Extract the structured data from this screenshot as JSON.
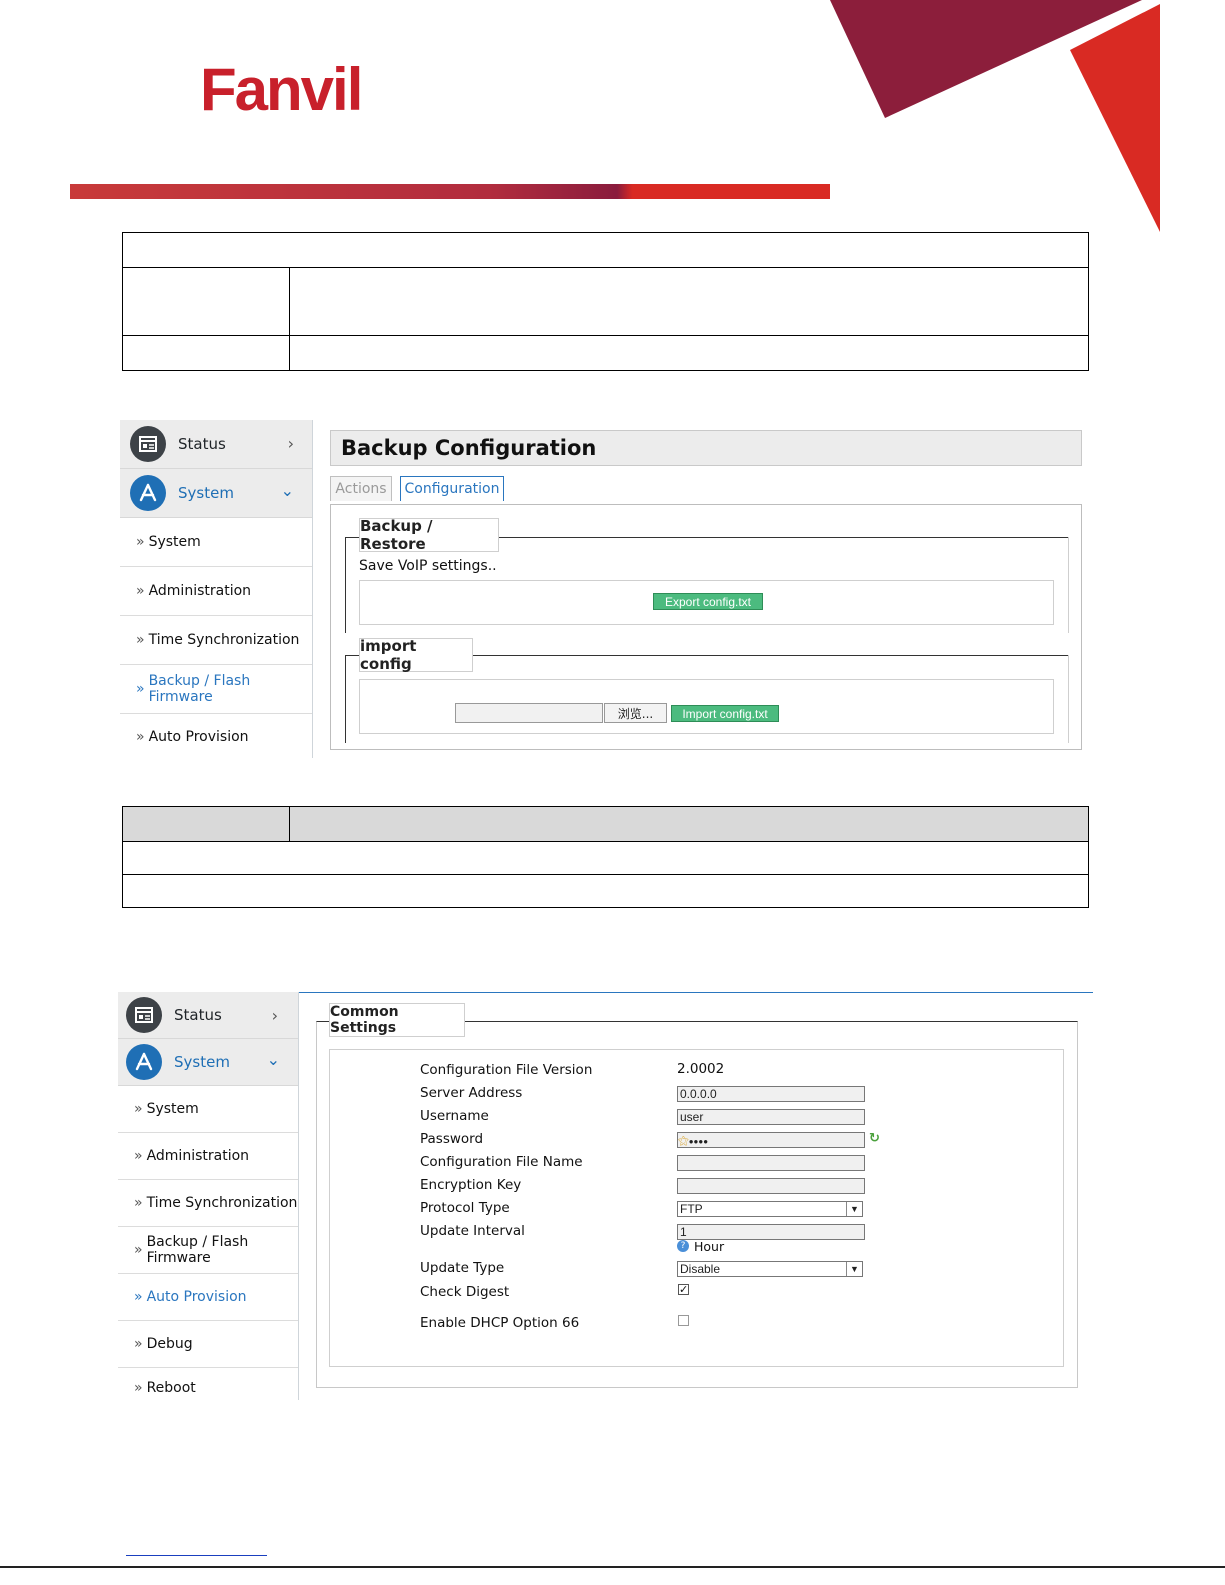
{
  "brand": {
    "logo_text": "Fanvil",
    "primary_color": "#c8202b",
    "accent_blue": "#2a76bf",
    "button_green": "#4cbb7f"
  },
  "backup_panel": {
    "sidebar": {
      "status_label": "Status",
      "system_label": "System",
      "items": [
        {
          "label": "System"
        },
        {
          "label": "Administration"
        },
        {
          "label": "Time Synchronization"
        },
        {
          "label": "Backup / Flash Firmware"
        },
        {
          "label": "Auto Provision"
        }
      ]
    },
    "title": "Backup Configuration",
    "tabs": [
      {
        "label": "Actions"
      },
      {
        "label": "Configuration"
      }
    ],
    "backup_restore": {
      "legend": "Backup / Restore",
      "description": "Save VoIP settings..",
      "export_button": "Export config.txt"
    },
    "import_config": {
      "legend": "import config",
      "browse_button": "浏览...",
      "import_button": "Import config.txt"
    }
  },
  "provision_panel": {
    "sidebar": {
      "status_label": "Status",
      "system_label": "System",
      "items": [
        {
          "label": "System"
        },
        {
          "label": "Administration"
        },
        {
          "label": "Time Synchronization"
        },
        {
          "label": "Backup / Flash Firmware"
        },
        {
          "label": "Auto Provision"
        },
        {
          "label": "Debug"
        },
        {
          "label": "Reboot"
        }
      ]
    },
    "common_settings": {
      "legend": "Common Settings",
      "fields": {
        "config_file_version": {
          "label": "Configuration File Version",
          "value": "2.0002"
        },
        "server_address": {
          "label": "Server Address",
          "value": "0.0.0.0"
        },
        "username": {
          "label": "Username",
          "value": "user"
        },
        "password": {
          "label": "Password",
          "value": "●●●●"
        },
        "config_file_name": {
          "label": "Configuration File Name",
          "value": ""
        },
        "encryption_key": {
          "label": "Encryption Key",
          "value": ""
        },
        "protocol_type": {
          "label": "Protocol Type",
          "value": "FTP"
        },
        "update_interval": {
          "label": "Update Interval",
          "value": "1",
          "unit": "Hour"
        },
        "update_type": {
          "label": "Update Type",
          "value": "Disable"
        },
        "check_digest": {
          "label": "Check Digest",
          "checked": true
        },
        "enable_dhcp_66": {
          "label": "Enable DHCP Option 66",
          "checked": false
        }
      }
    }
  }
}
